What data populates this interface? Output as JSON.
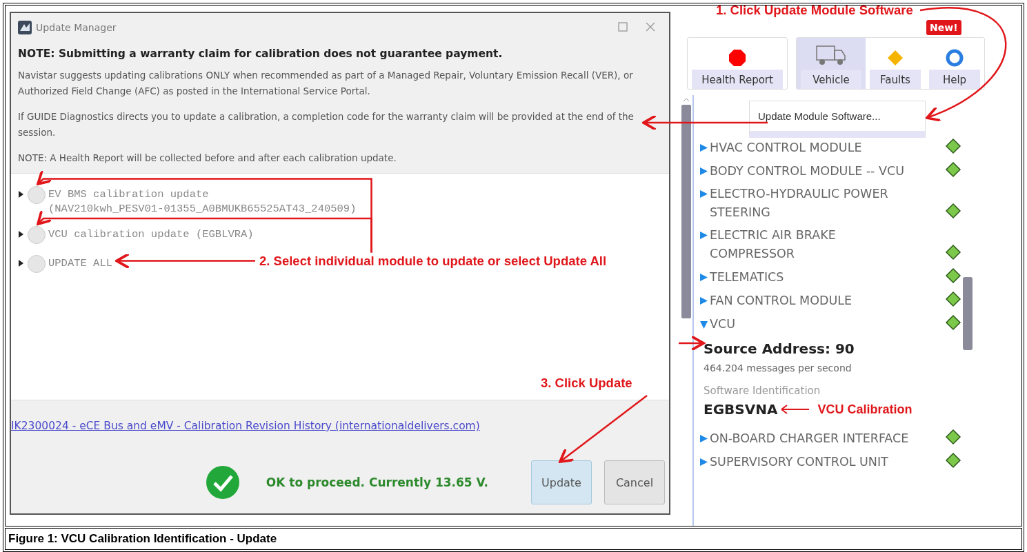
{
  "figure": {
    "caption": "Figure 1: VCU Calibration Identification - Update"
  },
  "update_manager": {
    "title": "Update Manager",
    "note_heading": "NOTE: Submitting a warranty claim for calibration does not guarantee payment.",
    "paragraphs": [
      "Navistar suggests updating calibrations ONLY when recommended as part of a Managed Repair, Voluntary Emission Recall (VER), or Authorized Field Change (AFC) as posted in the International Service Portal.",
      "If GUIDE Diagnostics directs you to update a calibration, a completion code for the warranty claim will be provided at the end of the session.",
      "NOTE: A Health Report will be collected before and after each calibration update."
    ],
    "options": [
      {
        "label": "EV BMS calibration update",
        "detail": "(NAV210kwh_PESV01-01355_A0BMUKB65525AT43_240509)",
        "selected": false
      },
      {
        "label": "VCU calibration update (EGBLVRA)",
        "selected": false
      },
      {
        "label": "UPDATE ALL",
        "selected": false
      }
    ],
    "link": "IK2300024 - eCE Bus and eMV - Calibration Revision History (internationaldelivers.com)",
    "status": "OK to proceed. Currently 13.65 V.",
    "buttons": [
      {
        "label": "Update",
        "kind": "primary"
      },
      {
        "label": "Cancel",
        "kind": "secondary"
      }
    ]
  },
  "vehicle_panel": {
    "tabs": [
      {
        "label": "Health Report",
        "kind": "health",
        "selected": false
      },
      {
        "label": "Vehicle",
        "kind": "vehicle",
        "selected": true
      },
      {
        "label": "Faults",
        "kind": "faults",
        "selected": false
      },
      {
        "label": "Help",
        "kind": "help",
        "selected": false,
        "badge": "New!"
      }
    ],
    "menu_item": "Update Module Software...",
    "modules": [
      {
        "name": "HVAC CONTROL MODULE",
        "expanded": false
      },
      {
        "name": "BODY CONTROL MODULE -- VCU",
        "expanded": false
      },
      {
        "name": "ELECTRO-HYDRAULIC POWER STEERING",
        "expanded": false
      },
      {
        "name": "ELECTRIC AIR BRAKE COMPRESSOR",
        "expanded": false
      },
      {
        "name": "TELEMATICS",
        "expanded": false
      },
      {
        "name": "FAN CONTROL MODULE",
        "expanded": false
      },
      {
        "name": "VCU",
        "expanded": true,
        "source_address": "Source Address: 90",
        "rate": "464.204 messages per second",
        "software_label": "Software Identification",
        "software_id": "EGBSVNA",
        "annotation": "VCU Calibration"
      },
      {
        "name": "ON-BOARD CHARGER INTERFACE",
        "expanded": false
      },
      {
        "name": "SUPERVISORY CONTROL UNIT",
        "expanded": false
      }
    ]
  },
  "annotations": [
    {
      "text": "1. Click Update Module Software",
      "kind": "step1"
    },
    {
      "text": "2. Select individual module to update or select Update All",
      "kind": "step2"
    },
    {
      "text": "3. Click Update",
      "kind": "step3"
    }
  ]
}
